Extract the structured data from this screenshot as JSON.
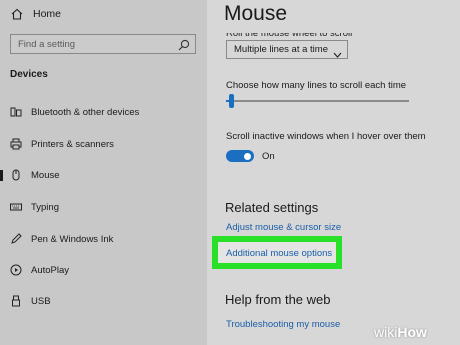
{
  "sidebar": {
    "home_label": "Home",
    "search_placeholder": "Find a setting",
    "section_label": "Devices",
    "items": [
      {
        "label": "Bluetooth & other devices",
        "icon": "bluetooth-devices-icon"
      },
      {
        "label": "Printers & scanners",
        "icon": "printer-icon"
      },
      {
        "label": "Mouse",
        "icon": "mouse-icon",
        "active": true
      },
      {
        "label": "Typing",
        "icon": "keyboard-icon"
      },
      {
        "label": "Pen & Windows Ink",
        "icon": "pen-icon"
      },
      {
        "label": "AutoPlay",
        "icon": "autoplay-icon"
      },
      {
        "label": "USB",
        "icon": "usb-icon"
      }
    ]
  },
  "main": {
    "title": "Mouse",
    "cut_label": "Roll the mouse wheel to scroll",
    "scroll_dropdown_value": "Multiple lines at a time",
    "lines_label": "Choose how many lines to scroll each time",
    "lines_slider_fraction": 0.03,
    "inactive_scroll_label": "Scroll inactive windows when I hover over them",
    "inactive_scroll_state": "On",
    "related_heading": "Related settings",
    "related_links": {
      "adjust": "Adjust mouse & cursor size",
      "additional": "Additional mouse options"
    },
    "help_heading": "Help from the web",
    "help_link": "Troubleshooting my mouse"
  },
  "colors": {
    "accent": "#1a6fc0",
    "link": "#1a5ea8",
    "highlight": "#28e028"
  },
  "watermark": {
    "wiki": "wiki",
    "how": "How"
  }
}
